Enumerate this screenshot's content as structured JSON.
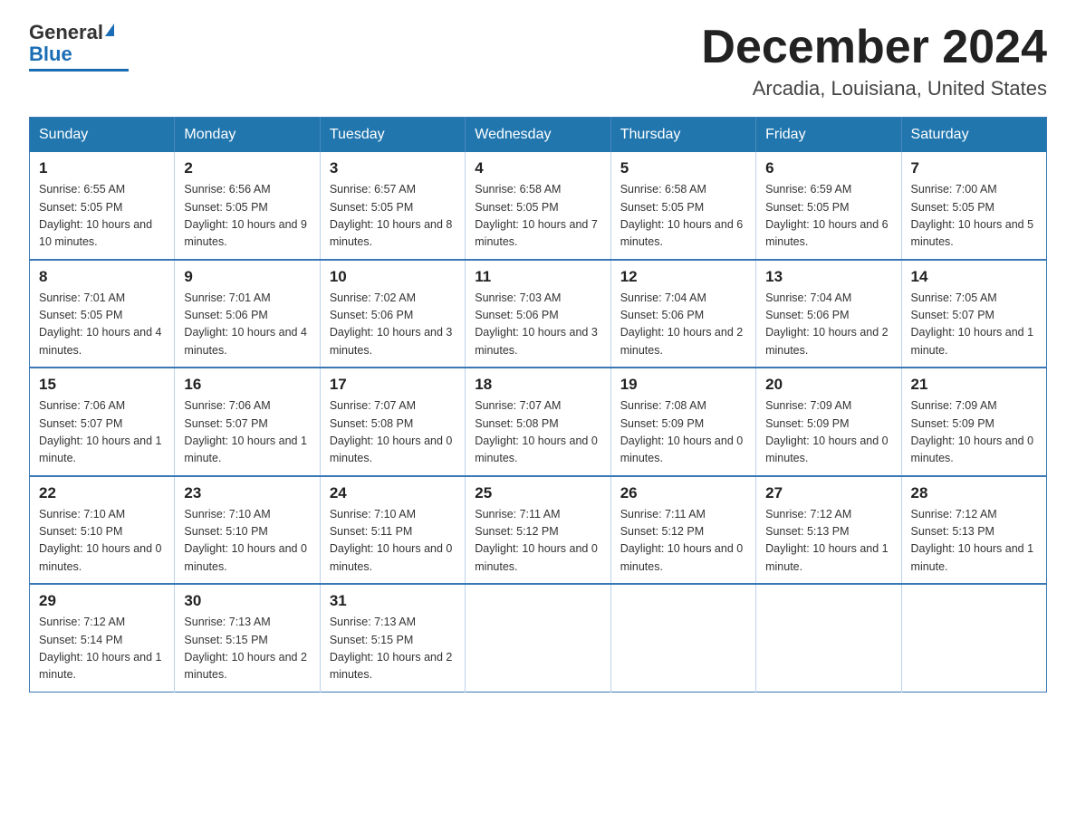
{
  "logo": {
    "general": "General",
    "blue": "Blue",
    "tagline": ""
  },
  "header": {
    "month_year": "December 2024",
    "location": "Arcadia, Louisiana, United States"
  },
  "weekdays": [
    "Sunday",
    "Monday",
    "Tuesday",
    "Wednesday",
    "Thursday",
    "Friday",
    "Saturday"
  ],
  "weeks": [
    [
      {
        "day": "1",
        "sunrise": "6:55 AM",
        "sunset": "5:05 PM",
        "daylight": "10 hours and 10 minutes."
      },
      {
        "day": "2",
        "sunrise": "6:56 AM",
        "sunset": "5:05 PM",
        "daylight": "10 hours and 9 minutes."
      },
      {
        "day": "3",
        "sunrise": "6:57 AM",
        "sunset": "5:05 PM",
        "daylight": "10 hours and 8 minutes."
      },
      {
        "day": "4",
        "sunrise": "6:58 AM",
        "sunset": "5:05 PM",
        "daylight": "10 hours and 7 minutes."
      },
      {
        "day": "5",
        "sunrise": "6:58 AM",
        "sunset": "5:05 PM",
        "daylight": "10 hours and 6 minutes."
      },
      {
        "day": "6",
        "sunrise": "6:59 AM",
        "sunset": "5:05 PM",
        "daylight": "10 hours and 6 minutes."
      },
      {
        "day": "7",
        "sunrise": "7:00 AM",
        "sunset": "5:05 PM",
        "daylight": "10 hours and 5 minutes."
      }
    ],
    [
      {
        "day": "8",
        "sunrise": "7:01 AM",
        "sunset": "5:05 PM",
        "daylight": "10 hours and 4 minutes."
      },
      {
        "day": "9",
        "sunrise": "7:01 AM",
        "sunset": "5:06 PM",
        "daylight": "10 hours and 4 minutes."
      },
      {
        "day": "10",
        "sunrise": "7:02 AM",
        "sunset": "5:06 PM",
        "daylight": "10 hours and 3 minutes."
      },
      {
        "day": "11",
        "sunrise": "7:03 AM",
        "sunset": "5:06 PM",
        "daylight": "10 hours and 3 minutes."
      },
      {
        "day": "12",
        "sunrise": "7:04 AM",
        "sunset": "5:06 PM",
        "daylight": "10 hours and 2 minutes."
      },
      {
        "day": "13",
        "sunrise": "7:04 AM",
        "sunset": "5:06 PM",
        "daylight": "10 hours and 2 minutes."
      },
      {
        "day": "14",
        "sunrise": "7:05 AM",
        "sunset": "5:07 PM",
        "daylight": "10 hours and 1 minute."
      }
    ],
    [
      {
        "day": "15",
        "sunrise": "7:06 AM",
        "sunset": "5:07 PM",
        "daylight": "10 hours and 1 minute."
      },
      {
        "day": "16",
        "sunrise": "7:06 AM",
        "sunset": "5:07 PM",
        "daylight": "10 hours and 1 minute."
      },
      {
        "day": "17",
        "sunrise": "7:07 AM",
        "sunset": "5:08 PM",
        "daylight": "10 hours and 0 minutes."
      },
      {
        "day": "18",
        "sunrise": "7:07 AM",
        "sunset": "5:08 PM",
        "daylight": "10 hours and 0 minutes."
      },
      {
        "day": "19",
        "sunrise": "7:08 AM",
        "sunset": "5:09 PM",
        "daylight": "10 hours and 0 minutes."
      },
      {
        "day": "20",
        "sunrise": "7:09 AM",
        "sunset": "5:09 PM",
        "daylight": "10 hours and 0 minutes."
      },
      {
        "day": "21",
        "sunrise": "7:09 AM",
        "sunset": "5:09 PM",
        "daylight": "10 hours and 0 minutes."
      }
    ],
    [
      {
        "day": "22",
        "sunrise": "7:10 AM",
        "sunset": "5:10 PM",
        "daylight": "10 hours and 0 minutes."
      },
      {
        "day": "23",
        "sunrise": "7:10 AM",
        "sunset": "5:10 PM",
        "daylight": "10 hours and 0 minutes."
      },
      {
        "day": "24",
        "sunrise": "7:10 AM",
        "sunset": "5:11 PM",
        "daylight": "10 hours and 0 minutes."
      },
      {
        "day": "25",
        "sunrise": "7:11 AM",
        "sunset": "5:12 PM",
        "daylight": "10 hours and 0 minutes."
      },
      {
        "day": "26",
        "sunrise": "7:11 AM",
        "sunset": "5:12 PM",
        "daylight": "10 hours and 0 minutes."
      },
      {
        "day": "27",
        "sunrise": "7:12 AM",
        "sunset": "5:13 PM",
        "daylight": "10 hours and 1 minute."
      },
      {
        "day": "28",
        "sunrise": "7:12 AM",
        "sunset": "5:13 PM",
        "daylight": "10 hours and 1 minute."
      }
    ],
    [
      {
        "day": "29",
        "sunrise": "7:12 AM",
        "sunset": "5:14 PM",
        "daylight": "10 hours and 1 minute."
      },
      {
        "day": "30",
        "sunrise": "7:13 AM",
        "sunset": "5:15 PM",
        "daylight": "10 hours and 2 minutes."
      },
      {
        "day": "31",
        "sunrise": "7:13 AM",
        "sunset": "5:15 PM",
        "daylight": "10 hours and 2 minutes."
      },
      null,
      null,
      null,
      null
    ]
  ]
}
